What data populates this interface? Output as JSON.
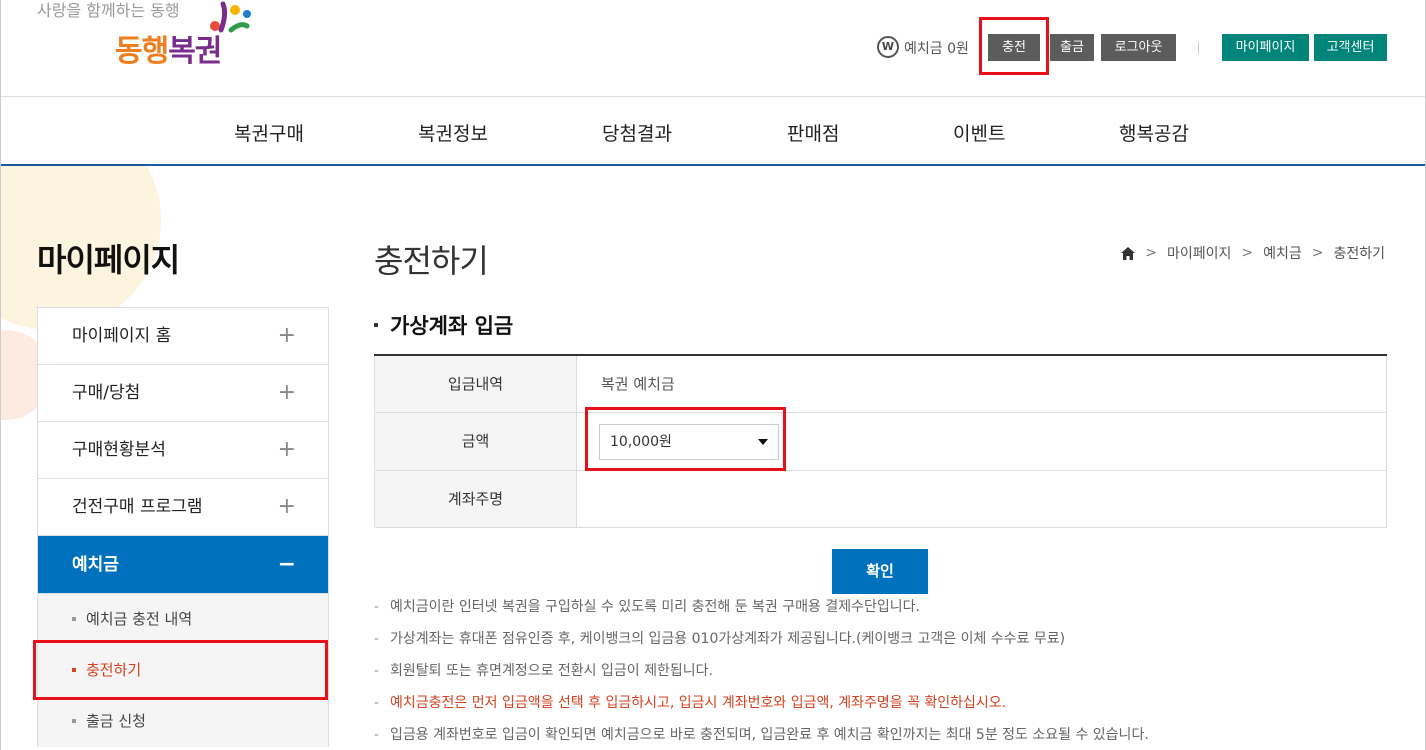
{
  "header": {
    "tagline": "사랑을 함께하는 동행",
    "logo": {
      "part1": "동행",
      "part2": "복권"
    },
    "wallet_icon": "W",
    "balance": "예치금 0원",
    "buttons": {
      "charge": "충전",
      "withdraw": "출금",
      "logout": "로그아웃",
      "mypage": "마이페이지",
      "support": "고객센터"
    }
  },
  "gnb": [
    "복권구매",
    "복권정보",
    "당첨결과",
    "판매점",
    "이벤트",
    "행복공감"
  ],
  "sidebar": {
    "title": "마이페이지",
    "items": [
      {
        "label": "마이페이지 홈",
        "sign": "+"
      },
      {
        "label": "구매/당첨",
        "sign": "+"
      },
      {
        "label": "구매현황분석",
        "sign": "+"
      },
      {
        "label": "건전구매 프로그램",
        "sign": "+"
      },
      {
        "label": "예치금",
        "sign": "−"
      }
    ],
    "sub_items": [
      "예치금 충전 내역",
      "충전하기",
      "출금 신청"
    ]
  },
  "content": {
    "page_title": "충전하기",
    "breadcrumb": [
      "마이페이지",
      "예치금",
      "충전하기"
    ],
    "section_title": "가상계좌 입금",
    "form": {
      "deposit_label": "입금내역",
      "deposit_value": "복권 예치금",
      "amount_label": "금액",
      "amount_value": "10,000원",
      "account_label": "계좌주명",
      "account_value": ""
    },
    "confirm_button": "확인",
    "notes": [
      "예치금이란 인터넷 복권을 구입하실 수 있도록 미리 충전해 둔 복권 구매용 결제수단입니다.",
      "가상계좌는 휴대폰 점유인증 후, 케이뱅크의 입금용 010가상계좌가 제공됩니다.(케이뱅크 고객은 이체 수수료 무료)",
      "회원탈퇴 또는 휴면계정으로 전환시 입금이 제한됩니다.",
      "예치금충전은 먼저 입금액을 선택 후 입금하시고, 입금시 계좌번호와 입금액, 계좌주명을 꼭 확인하십시오.",
      "입금용 계좌번호로 입금이 확인되면 예치금으로 바로 충전되며, 입금완료 후 예치금 확인까지는 최대 5분 정도 소요될 수 있습니다."
    ],
    "note_marker": "-"
  },
  "colors": {
    "primary": "#0071bc",
    "teal": "#00857a",
    "highlight": "#e8111a",
    "warning": "#d4421e"
  },
  "icons": [
    "wallet-icon",
    "home-icon",
    "chevron-right-icon",
    "dropdown-arrow-icon"
  ]
}
